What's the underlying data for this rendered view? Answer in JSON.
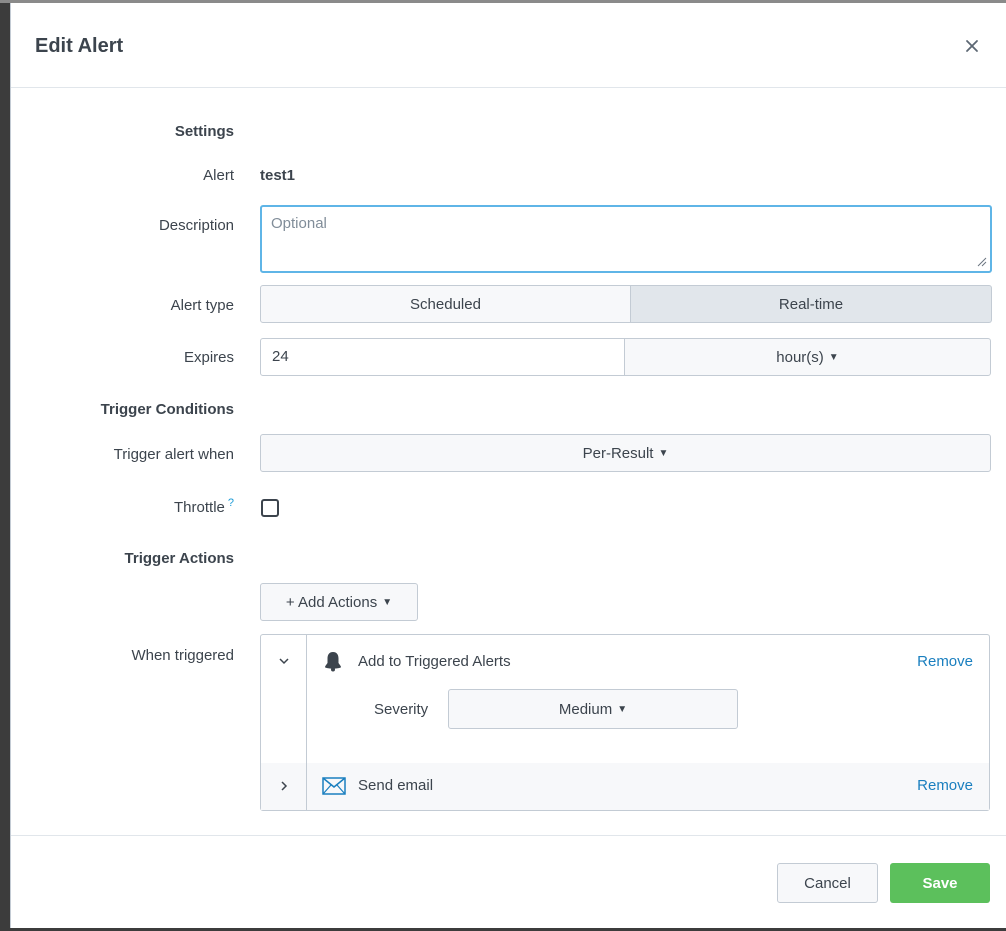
{
  "dialog": {
    "title": "Edit Alert"
  },
  "settings": {
    "section_label": "Settings",
    "alert_label": "Alert",
    "alert_value": "test1",
    "description_label": "Description",
    "description_placeholder": "Optional",
    "description_value": "",
    "alert_type_label": "Alert type",
    "alert_type_options": [
      "Scheduled",
      "Real-time"
    ],
    "alert_type_selected": "Real-time",
    "expires_label": "Expires",
    "expires_value": "24",
    "expires_unit": "hour(s)"
  },
  "trigger_conditions": {
    "section_label": "Trigger Conditions",
    "trigger_label": "Trigger alert when",
    "trigger_value": "Per-Result",
    "throttle_label": "Throttle",
    "throttle_help": "?",
    "throttle_checked": false
  },
  "trigger_actions": {
    "section_label": "Trigger Actions",
    "add_actions_label": "+ Add Actions",
    "when_triggered_label": "When triggered",
    "actions": [
      {
        "name": "Add to Triggered Alerts",
        "icon": "bell-icon",
        "expanded": true,
        "remove_label": "Remove",
        "severity_label": "Severity",
        "severity_value": "Medium"
      },
      {
        "name": "Send email",
        "icon": "envelope-icon",
        "expanded": false,
        "remove_label": "Remove"
      }
    ]
  },
  "footer": {
    "cancel_label": "Cancel",
    "save_label": "Save"
  },
  "colors": {
    "accent_blue": "#1a7fbf",
    "focus_border": "#5fb5e7",
    "save_green": "#5cc05c"
  }
}
